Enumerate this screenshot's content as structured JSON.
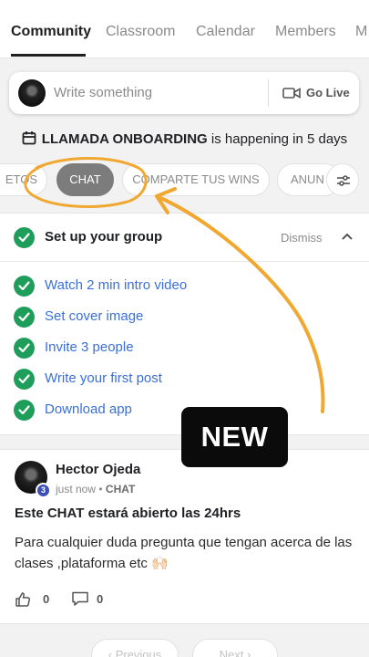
{
  "tabs": [
    {
      "label": "Community",
      "active": true
    },
    {
      "label": "Classroom",
      "active": false
    },
    {
      "label": "Calendar",
      "active": false
    },
    {
      "label": "Members",
      "active": false
    },
    {
      "label": "M",
      "active": false
    }
  ],
  "composer": {
    "placeholder": "Write something",
    "go_live_label": "Go Live",
    "go_live_icon": "video-camera-icon"
  },
  "event": {
    "icon": "calendar-icon",
    "name": "LLAMADA ONBOARDING",
    "suffix": "is happening in 5 days"
  },
  "categories": [
    {
      "label": "ETOS",
      "selected": false
    },
    {
      "label": "CHAT",
      "selected": true
    },
    {
      "label": "COMPARTE TUS WINS",
      "selected": false
    },
    {
      "label": "ANUN",
      "selected": false
    }
  ],
  "setup": {
    "title": "Set up your group",
    "dismiss_label": "Dismiss",
    "tasks": [
      {
        "label": "Watch 2 min intro video",
        "done": true
      },
      {
        "label": "Set cover image",
        "done": true
      },
      {
        "label": "Invite 3 people",
        "done": true
      },
      {
        "label": "Write your first post",
        "done": true
      },
      {
        "label": "Download app",
        "done": true
      }
    ]
  },
  "post": {
    "author": "Hector Ojeda",
    "level": "3",
    "time": "just now",
    "separator": "•",
    "category": "CHAT",
    "title": "Este CHAT estará abierto las 24hrs",
    "body": "Para cualquier duda pregunta que tengan acerca de las clases ,plataforma etc 🙌🏻",
    "likes": "0",
    "comments": "0"
  },
  "pagination": {
    "previous_label": "Previous",
    "next_label": "Next"
  },
  "overlay": {
    "badge_text": "NEW",
    "highlight_color": "#f0a830"
  },
  "colors": {
    "check_green": "#1e9e5a",
    "link_blue": "#3b6fd8",
    "chip_selected": "#7c7c7c"
  }
}
